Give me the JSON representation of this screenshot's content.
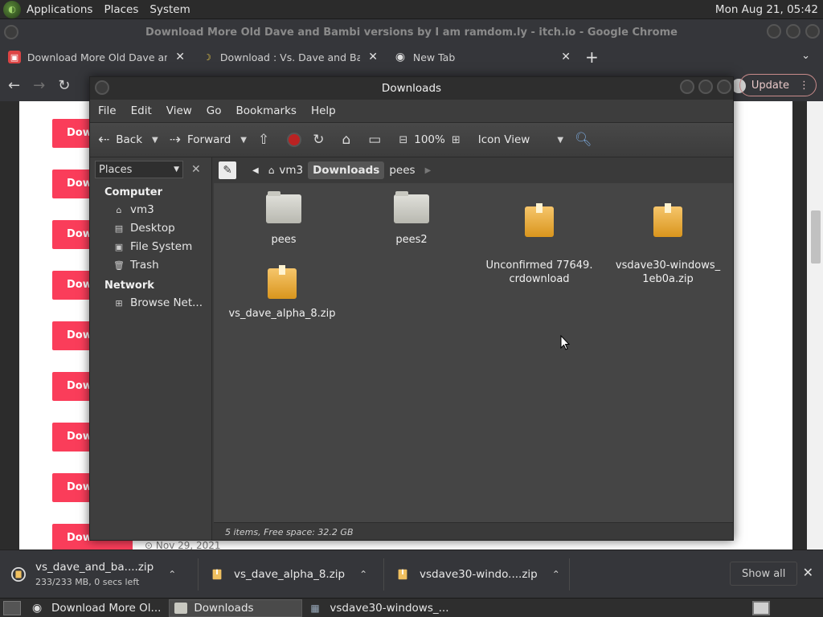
{
  "top_panel": {
    "menus": [
      "Applications",
      "Places",
      "System"
    ],
    "clock": "Mon Aug 21, 05:42"
  },
  "chrome": {
    "window_title": "Download More Old Dave and Bambi versions by I am ramdom.ly - itch.io - Google Chrome",
    "tabs": [
      {
        "label": "Download More Old Dave and",
        "icon": "itchio-icon",
        "active": false
      },
      {
        "label": "Download : Vs. Dave and Bamb",
        "icon": "banana-icon",
        "active": true
      },
      {
        "label": "New Tab",
        "icon": "chrome-icon",
        "active": false
      }
    ],
    "update_label": "Update"
  },
  "webpage": {
    "download_buttons": [
      "Dow",
      "Dow",
      "Dow",
      "Dow",
      "Dow",
      "Dow",
      "Dow",
      "Dow",
      "Download"
    ],
    "date": "Nov 29, 2021"
  },
  "file_manager": {
    "title": "Downloads",
    "menu": [
      "File",
      "Edit",
      "View",
      "Go",
      "Bookmarks",
      "Help"
    ],
    "toolbar": {
      "back": "Back",
      "forward": "Forward",
      "zoom": "100%",
      "view_mode": "Icon View"
    },
    "sidebar": {
      "selector": "Places",
      "sections": [
        {
          "title": "Computer",
          "items": [
            {
              "label": "vm3",
              "icon": "home-folder-icon"
            },
            {
              "label": "Desktop",
              "icon": "desktop-folder-icon"
            },
            {
              "label": "File System",
              "icon": "drive-icon"
            },
            {
              "label": "Trash",
              "icon": "trash-icon"
            }
          ]
        },
        {
          "title": "Network",
          "items": [
            {
              "label": "Browse Net...",
              "icon": "network-icon"
            }
          ]
        }
      ]
    },
    "path": [
      "vm3",
      "Downloads",
      "pees"
    ],
    "active_path": "Downloads",
    "files": [
      {
        "name": "pees",
        "type": "folder"
      },
      {
        "name": "pees2",
        "type": "folder"
      },
      {
        "name": "Unconfirmed 77649.\ncrdownload",
        "type": "package"
      },
      {
        "name": "vsdave30-windows_\n1eb0a.zip",
        "type": "package"
      },
      {
        "name": "vs_dave_alpha_8.zip",
        "type": "package"
      }
    ],
    "status": "5 items, Free space: 32.2 GB"
  },
  "download_shelf": {
    "items": [
      {
        "name": "vs_dave_and_ba....zip",
        "sub": "233/233 MB, 0 secs left"
      },
      {
        "name": "vs_dave_alpha_8.zip",
        "sub": ""
      },
      {
        "name": "vsdave30-windo....zip",
        "sub": ""
      }
    ],
    "show_all": "Show all"
  },
  "taskbar": {
    "tasks": [
      {
        "label": "Download More Ol...",
        "icon": "chrome-icon",
        "active": false
      },
      {
        "label": "Downloads",
        "icon": "folder-icon",
        "active": true
      },
      {
        "label": "vsdave30-windows_...",
        "icon": "archive-icon",
        "active": false
      }
    ]
  }
}
